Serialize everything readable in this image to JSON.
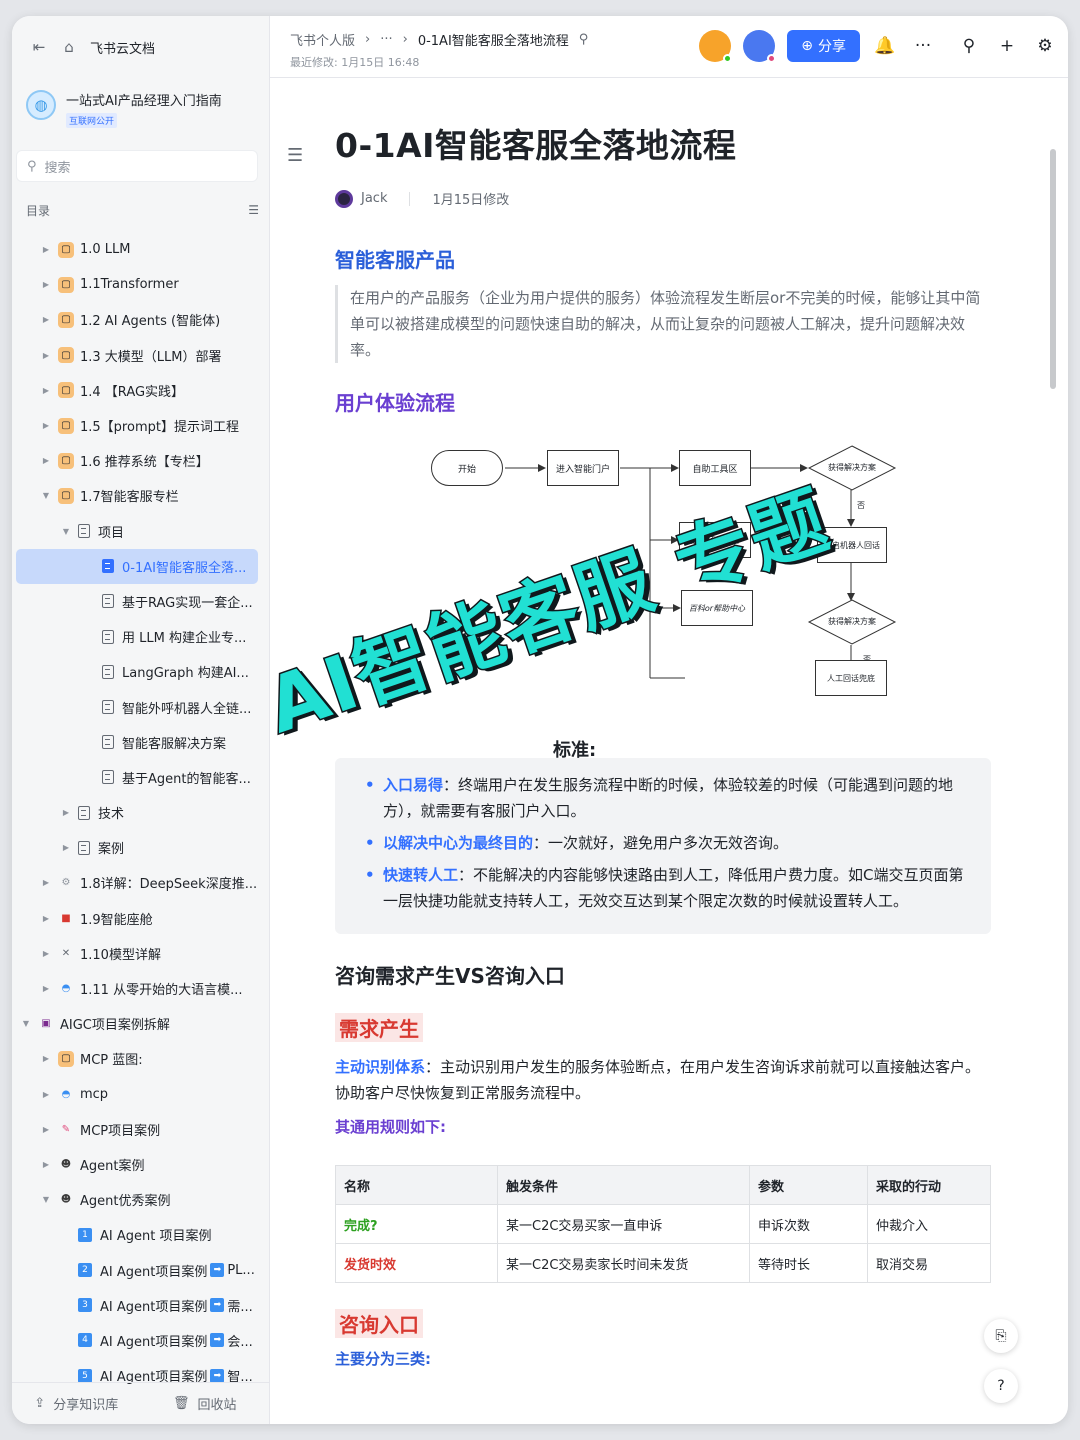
{
  "sidebar": {
    "home_label": "飞书云文档",
    "kb_title": "一站式AI产品经理入门指南",
    "kb_badge": "互联网公开",
    "search_placeholder": "搜索",
    "toc_label": "目录",
    "items": [
      {
        "label": "1.0 LLM",
        "icon": "#f7a44a"
      },
      {
        "label": "1.1Transformer",
        "icon": "#f7a44a"
      },
      {
        "label": "1.2 AI Agents (智能体)",
        "icon": "#f7a44a"
      },
      {
        "label": "1.3 大模型（LLM）部署",
        "icon": "#f7a44a"
      },
      {
        "label": "1.4 【RAG实践】",
        "icon": "#f7a44a"
      },
      {
        "label": "1.5【prompt】提示词工程",
        "icon": "#f7a44a"
      },
      {
        "label": "1.6 推荐系统【专栏】",
        "icon": "#f7a44a"
      },
      {
        "label": "1.7智能客服专栏",
        "icon": "#f7a44a"
      },
      {
        "label": "项目"
      },
      {
        "label": "0-1AI智能客服全落..."
      },
      {
        "label": "基于RAG实现一套企..."
      },
      {
        "label": "用 LLM 构建企业专..."
      },
      {
        "label": "LangGraph 构建AI..."
      },
      {
        "label": "智能外呼机器人全链..."
      },
      {
        "label": "智能客服解决方案"
      },
      {
        "label": "基于Agent的智能客..."
      },
      {
        "label": "技术"
      },
      {
        "label": "案例"
      },
      {
        "label": "1.8详解：DeepSeek深度推..."
      },
      {
        "label": "1.9智能座舱"
      },
      {
        "label": "1.10模型详解"
      },
      {
        "label": "1.11 从零开始的大语言模..."
      },
      {
        "label": "AIGC项目案例拆解"
      },
      {
        "label": "MCP 蓝图:"
      },
      {
        "label": "mcp"
      },
      {
        "label": "MCP项目案例"
      },
      {
        "label": "Agent案例"
      },
      {
        "label": "Agent优秀案例"
      },
      {
        "label": "AI Agent 项目案例",
        "num": "1"
      },
      {
        "label": "AI Agent项目案例",
        "num": "2",
        "suffix": "PL..."
      },
      {
        "label": "AI Agent项目案例",
        "num": "3",
        "suffix": "需..."
      },
      {
        "label": "AI Agent项目案例",
        "num": "4",
        "suffix": "会..."
      },
      {
        "label": "AI Agent项目案例",
        "num": "5",
        "suffix": "智..."
      }
    ],
    "share_kb": "分享知识库",
    "recycle": "回收站"
  },
  "header": {
    "crumb_root": "飞书个人版",
    "crumb_more": "···",
    "crumb_current": "0-1AI智能客服全落地流程",
    "modified": "最近修改: 1月15日 16:48",
    "share_label": "分享",
    "more_label": "···"
  },
  "doc": {
    "title": "0-1AI智能客服全落地流程",
    "author": "Jack",
    "modified": "1月15日修改",
    "h1": "智能客服产品",
    "quote": "在用户的产品服务（企业为用户提供的服务）体验流程发生断层or不完美的时候，能够让其中简单可以被搭建成模型的问题快速自助的解决，从而让复杂的问题被人工解决，提升问题解决效率。",
    "h2": "用户体验流程",
    "flow": {
      "start": "开始",
      "portal": "进入智能门户",
      "self_tool": "自助工具区",
      "get_solution_1": "获得解决方案",
      "no_1": "否",
      "preset": "选择预判问题",
      "robot": "开启机器人回话",
      "faq": "百科or帮助中心",
      "get_solution_2": "获得解决方案",
      "no_2": "否",
      "human": "人工回话兜底"
    },
    "hidden_heading_tail": "标准:",
    "bullets": [
      {
        "key": "入口易得",
        "text": "：终端用户在发生服务流程中断的时候，体验较差的时候（可能遇到问题的地方），就需要有客服门户入口。"
      },
      {
        "key": "以解决中心为最终目的",
        "text": "：一次就好，避免用户多次无效咨询。"
      },
      {
        "key": "快速转人工",
        "text": "：不能解决的内容能够快速路由到人工，降低用户费力度。如C端交互页面第一层快捷功能就支持转人工，无效交互达到某个限定次数的时候就设置转人工。"
      }
    ],
    "h3": "咨询需求产生VS咨询入口",
    "h4": "需求产生",
    "p1_key": "主动识别体系",
    "p1_text": "：主动识别用户发生的服务体验断点，在用户发生咨询诉求前就可以直接触达客户。协助客户尽快恢复到正常服务流程中。",
    "rules_label": "其通用规则如下:",
    "table": {
      "headers": [
        "名称",
        "触发条件",
        "参数",
        "采取的行动"
      ],
      "rows": [
        [
          "完成?",
          "某一C2C交易买家一直申诉",
          "申诉次数",
          "仲裁介入"
        ],
        [
          "发货时效",
          "某一C2C交易卖家长时间未发货",
          "等待时长",
          "取消交易"
        ]
      ]
    },
    "h5": "咨询入口",
    "main_three": "主要分为三类:"
  },
  "overlay": {
    "banner": "AI智能客服 专题"
  },
  "colors": {
    "accent": "#3370ff",
    "banner": "#21e0d3"
  }
}
